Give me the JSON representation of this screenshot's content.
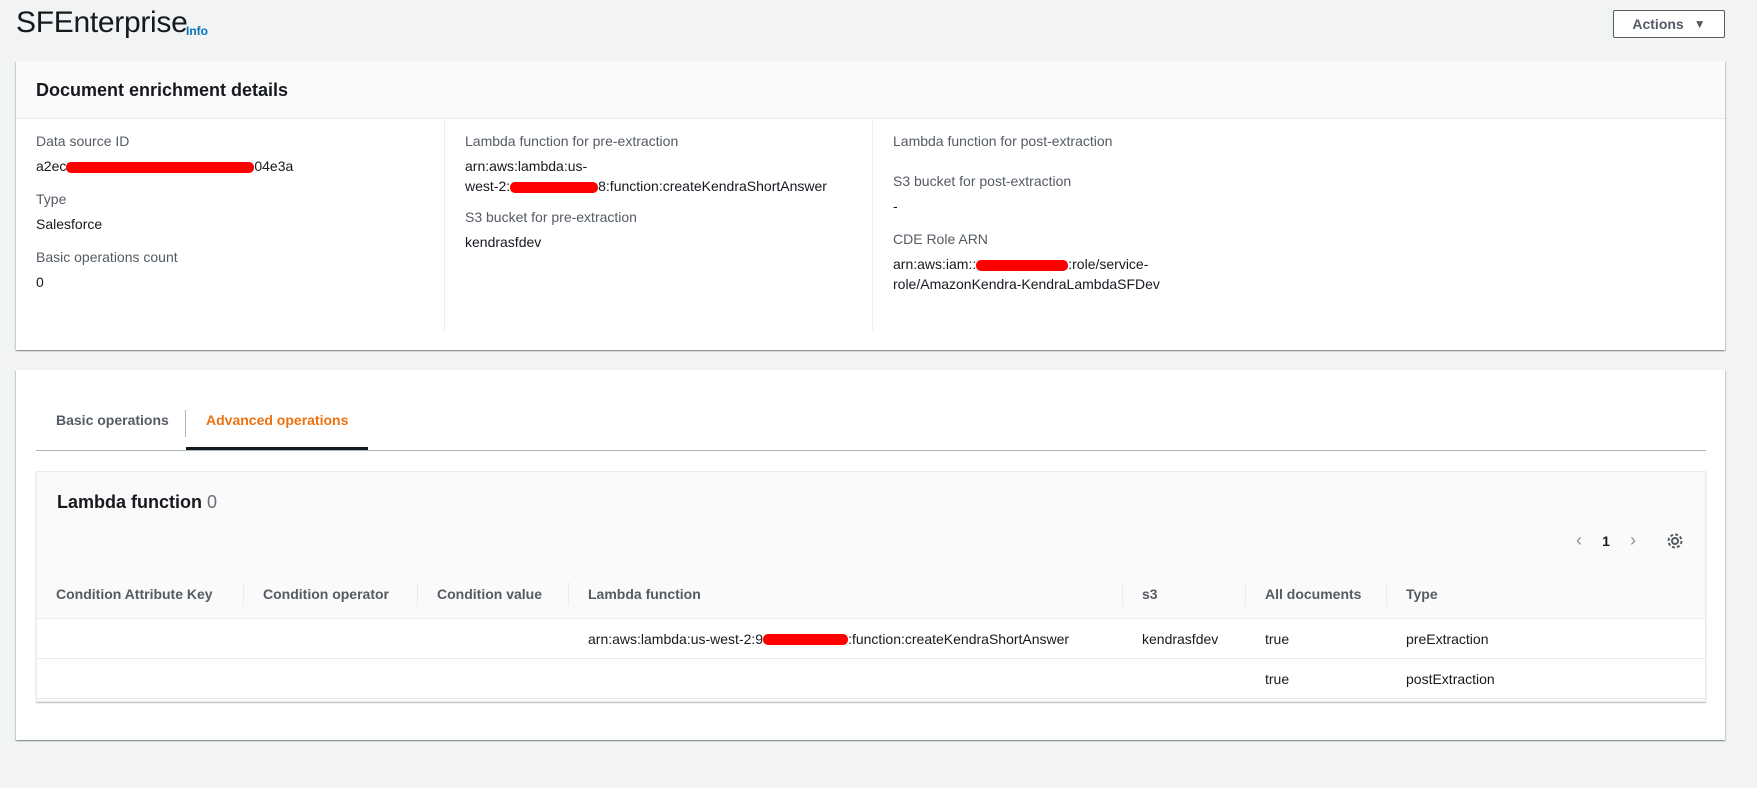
{
  "header": {
    "title": "SFEnterprise",
    "info_label": "Info",
    "actions_label": "Actions"
  },
  "details": {
    "title": "Document enrichment details",
    "data_source_id": {
      "label": "Data source ID",
      "value_prefix": "a2ec",
      "value_suffix": "04e3a"
    },
    "type": {
      "label": "Type",
      "value": "Salesforce"
    },
    "basic_ops_count": {
      "label": "Basic operations count",
      "value": "0"
    },
    "pre_lambda": {
      "label": "Lambda function for pre-extraction",
      "value_line1": "arn:aws:lambda:us-",
      "value_line2_prefix": "west-2:",
      "value_line2_suffix": "8:function:createKendraShortAnswer"
    },
    "pre_s3": {
      "label": "S3 bucket for pre-extraction",
      "value": "kendrasfdev"
    },
    "post_lambda": {
      "label": "Lambda function for post-extraction",
      "value": ""
    },
    "post_s3": {
      "label": "S3 bucket for post-extraction",
      "value": "-"
    },
    "cde_role": {
      "label": "CDE Role ARN",
      "value_line1_prefix": "arn:aws:iam::",
      "value_line1_suffix": ":role/service-",
      "value_line2": "role/AmazonKendra-KendraLambdaSFDev"
    }
  },
  "tabs": {
    "basic": "Basic operations",
    "advanced": "Advanced operations"
  },
  "lambda_table": {
    "title": "Lambda function",
    "count": "0",
    "page": "1",
    "columns": [
      "Condition Attribute Key",
      "Condition operator",
      "Condition value",
      "Lambda function",
      "s3",
      "All documents",
      "Type"
    ],
    "rows": [
      {
        "key": "",
        "operator": "",
        "value": "",
        "lambda_prefix": "arn:aws:lambda:us-west-2:9",
        "lambda_suffix": ":function:createKendraShortAnswer",
        "s3": "kendrasfdev",
        "all_docs": "true",
        "type": "preExtraction"
      },
      {
        "key": "",
        "operator": "",
        "value": "",
        "lambda_prefix": "",
        "lambda_suffix": "",
        "s3": "",
        "all_docs": "true",
        "type": "postExtraction"
      }
    ]
  },
  "colors": {
    "accent": "#ec7211",
    "link": "#0073bb",
    "redaction": "#ff0000"
  }
}
